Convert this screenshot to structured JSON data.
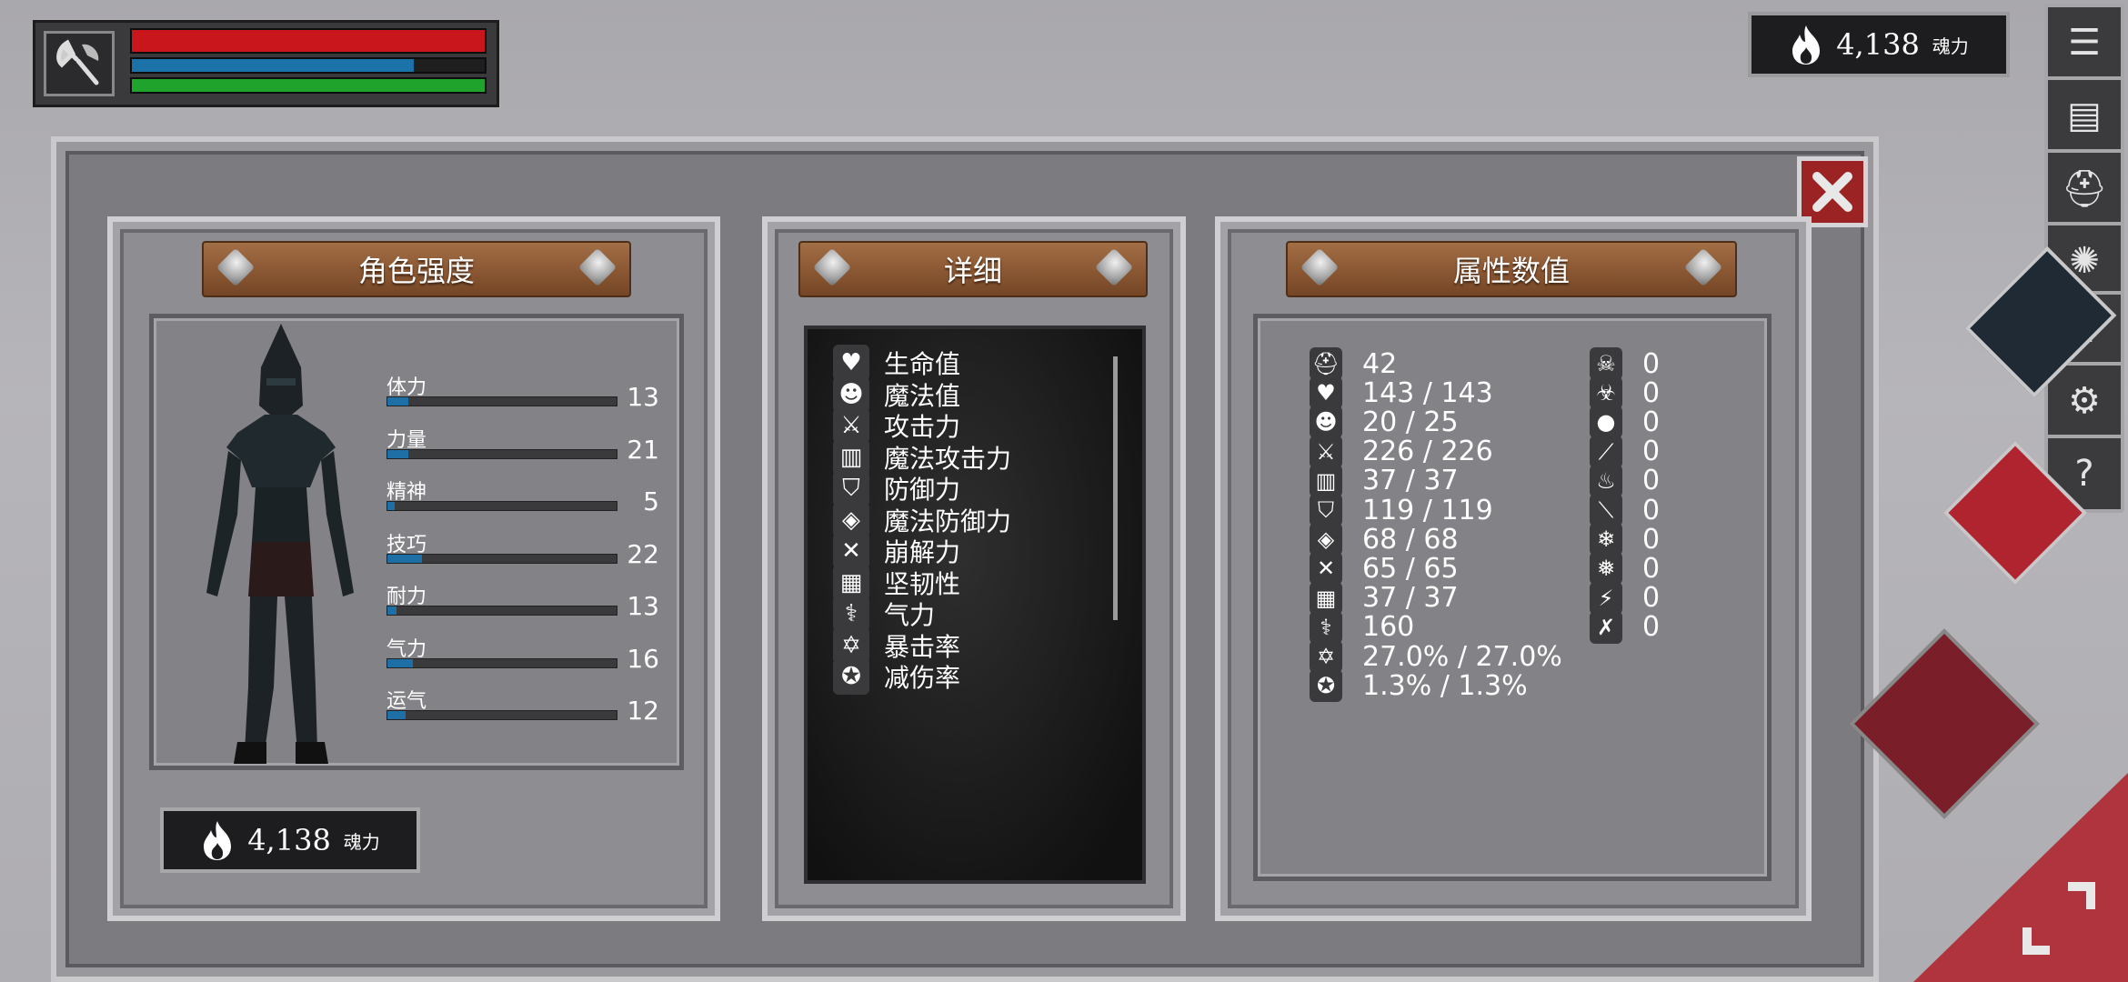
{
  "hud": {
    "weapon_icon": "axe-icon",
    "health": 1.0,
    "mana": 0.8,
    "stamina": 1.0,
    "colors": {
      "health": "#c8161c",
      "mana": "#1b72a8",
      "stamina": "#1fa32c"
    }
  },
  "soul_top": {
    "value": "4,138",
    "label": "魂力",
    "icon": "flame-icon"
  },
  "side_buttons": [
    {
      "name": "menu-list-icon",
      "glyph": "☰"
    },
    {
      "name": "journal-icon",
      "glyph": "▤"
    },
    {
      "name": "helmet-icon",
      "glyph": "⛑"
    },
    {
      "name": "emblem-icon",
      "glyph": "✺"
    },
    {
      "name": "crown-icon",
      "glyph": "♛"
    },
    {
      "name": "settings-gear-icon",
      "glyph": "⚙"
    },
    {
      "name": "help-icon",
      "glyph": "?"
    }
  ],
  "panels": {
    "character": {
      "title": "角色强度"
    },
    "detail": {
      "title": "详细"
    },
    "attributes": {
      "title": "属性数值"
    }
  },
  "stats": [
    {
      "label": "体力",
      "value": "13",
      "fill": 0.09
    },
    {
      "label": "力量",
      "value": "21",
      "fill": 0.09
    },
    {
      "label": "精神",
      "value": "5",
      "fill": 0.03
    },
    {
      "label": "技巧",
      "value": "22",
      "fill": 0.15
    },
    {
      "label": "耐力",
      "value": "13",
      "fill": 0.04
    },
    {
      "label": "气力",
      "value": "16",
      "fill": 0.11
    },
    {
      "label": "运气",
      "value": "12",
      "fill": 0.08
    }
  ],
  "detail_items": [
    {
      "label": "生命值",
      "icon": "heart-icon"
    },
    {
      "label": "魔法值",
      "icon": "head-icon"
    },
    {
      "label": "攻击力",
      "icon": "sword-icon"
    },
    {
      "label": "魔法攻击力",
      "icon": "spellbook-icon"
    },
    {
      "label": "防御力",
      "icon": "shield-icon"
    },
    {
      "label": "魔法防御力",
      "icon": "magic-shield-icon"
    },
    {
      "label": "崩解力",
      "icon": "shatter-icon"
    },
    {
      "label": "坚韧性",
      "icon": "visor-helmet-icon"
    },
    {
      "label": "气力",
      "icon": "lungs-icon"
    },
    {
      "label": "暴击率",
      "icon": "critical-star-icon"
    },
    {
      "label": "减伤率",
      "icon": "damage-reduction-icon"
    }
  ],
  "attributes_left": [
    {
      "icon": "helmet-icon",
      "value": "42"
    },
    {
      "icon": "heart-icon",
      "value": "143 / 143"
    },
    {
      "icon": "head-icon",
      "value": "20 / 25"
    },
    {
      "icon": "sword-icon",
      "value": "226 / 226"
    },
    {
      "icon": "spellbook-icon",
      "value": "37 / 37"
    },
    {
      "icon": "shield-icon",
      "value": "119 / 119"
    },
    {
      "icon": "magic-shield-icon",
      "value": "68 / 68"
    },
    {
      "icon": "shatter-icon",
      "value": "65 / 65"
    },
    {
      "icon": "visor-helmet-icon",
      "value": "37 / 37"
    },
    {
      "icon": "lungs-icon",
      "value": "160"
    },
    {
      "icon": "critical-star-icon",
      "value": "27.0% / 27.0%"
    },
    {
      "icon": "damage-reduction-icon",
      "value": "1.3% / 1.3%"
    }
  ],
  "attributes_right": [
    {
      "icon": "poison-skull-icon",
      "value": "0"
    },
    {
      "icon": "disease-icon",
      "value": "0"
    },
    {
      "icon": "bleed-drop-icon",
      "value": "0"
    },
    {
      "icon": "slash-resist-icon",
      "value": "0"
    },
    {
      "icon": "fire-icon",
      "value": "0"
    },
    {
      "icon": "burn-resist-icon",
      "value": "0"
    },
    {
      "icon": "frost-icon",
      "value": "0"
    },
    {
      "icon": "frost-resist-icon",
      "value": "0"
    },
    {
      "icon": "lightning-icon",
      "value": "0"
    },
    {
      "icon": "lightning-resist-icon",
      "value": "0"
    }
  ],
  "soul_bottom": {
    "value": "4,138",
    "label": "魂力",
    "icon": "flame-icon"
  }
}
